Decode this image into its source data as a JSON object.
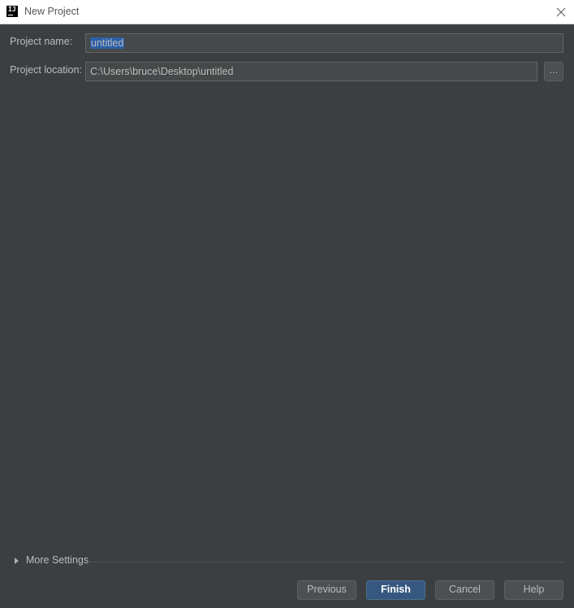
{
  "window": {
    "title": "New Project",
    "app_icon_text": "IJ"
  },
  "form": {
    "project_name_label": "Project name:",
    "project_name_value": "untitled",
    "project_location_label": "Project location:",
    "project_location_value": "C:\\Users\\bruce\\Desktop\\untitled",
    "browse_label": "..."
  },
  "more_settings": {
    "label": "More Settings",
    "expanded": false
  },
  "buttons": {
    "previous": "Previous",
    "finish": "Finish",
    "cancel": "Cancel",
    "help": "Help"
  },
  "colors": {
    "background": "#3c3f41",
    "text": "#bbbbbb",
    "primary_button": "#365880",
    "selection": "#2d5fa8"
  },
  "icons": {
    "app": "intellij-idea-icon",
    "close": "close-icon",
    "expand": "triangle-right-icon"
  }
}
